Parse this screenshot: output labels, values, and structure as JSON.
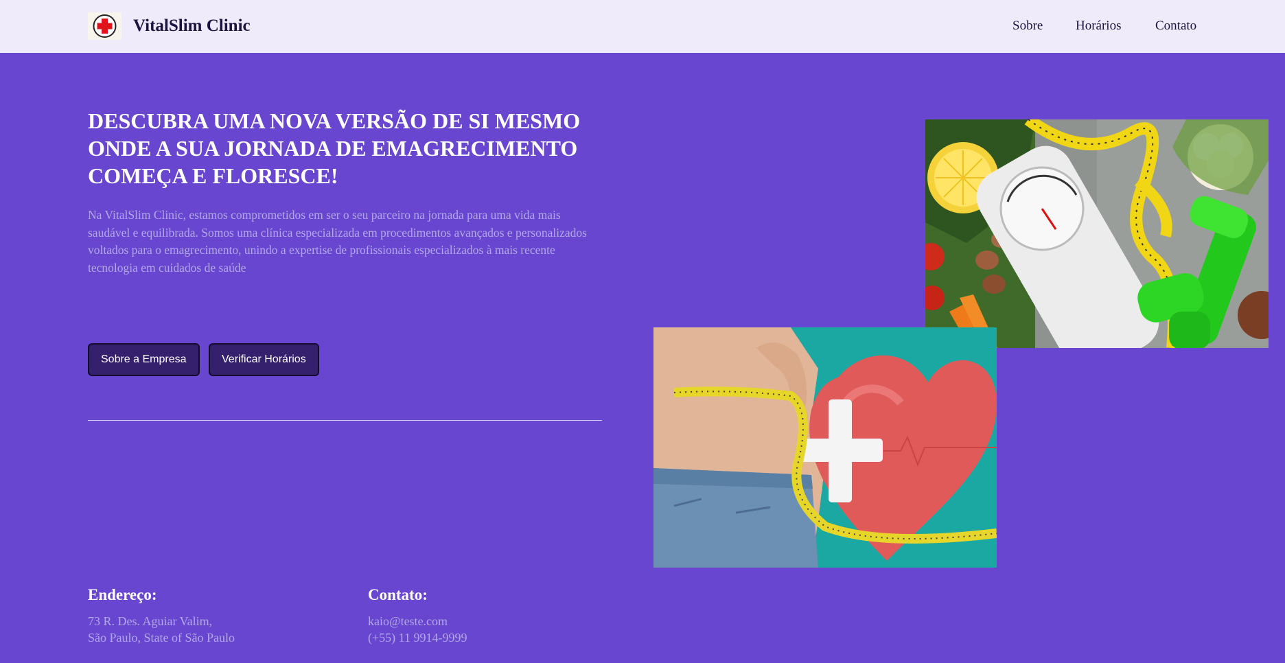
{
  "header": {
    "brand": "VitalSlim Clinic",
    "logo_icon": "red-cross-icon",
    "nav": [
      "Sobre",
      "Horários",
      "Contato"
    ]
  },
  "hero": {
    "title": "DESCUBRA UMA NOVA VERSÃO DE SI MESMO ONDE A SUA JORNADA DE EMAGRECIMENTO COMEÇA E FLORESCE!",
    "description": "Na VitalSlim Clinic, estamos comprometidos em ser o seu parceiro na jornada para uma vida mais saudável e equilibrada. Somos uma clínica especializada em procedimentos avançados e personalizados voltados para o emagrecimento, unindo a expertise de profissionais especializados à mais recente tecnologia em cuidados de saúde",
    "buttons": {
      "about": "Sobre a Empresa",
      "schedule": "Verificar Horários"
    }
  },
  "footer": {
    "address": {
      "heading": "Endereço:",
      "line1": "73 R. Des. Aguiar Valim,",
      "line2": "São Paulo, State of São Paulo"
    },
    "contact": {
      "heading": "Contato:",
      "email": "kaio@teste.com",
      "phone": "(+55) 11 9914-9999"
    }
  },
  "colors": {
    "background": "#6846d0",
    "header_bg": "#efebfb",
    "button_bg": "#35206e",
    "muted_text": "#b3a8e6"
  }
}
